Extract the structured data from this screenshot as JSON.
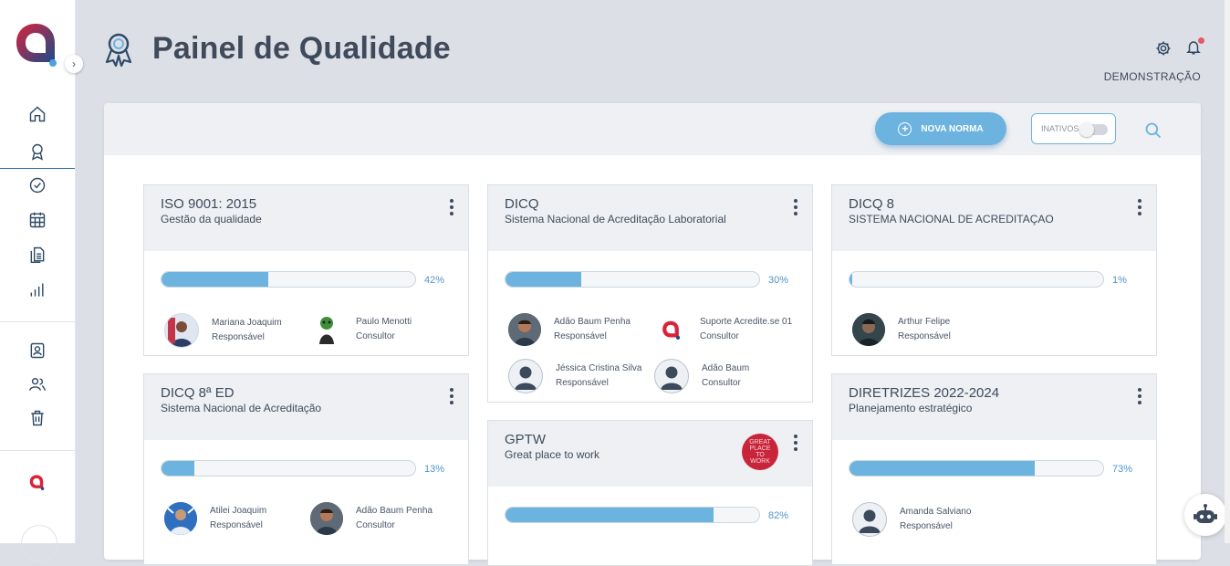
{
  "page": {
    "title": "Painel de Qualidade"
  },
  "header": {
    "company": "DEMONSTRAÇÃO"
  },
  "toolbar": {
    "new_norm_label": "NOVA NORMA",
    "inactive_label": "INATIVOS"
  },
  "sidebar": {
    "items": [
      {
        "icon": "home-icon"
      },
      {
        "icon": "award-icon",
        "active": true
      },
      {
        "icon": "check-circle-icon"
      },
      {
        "icon": "calendar-icon"
      },
      {
        "icon": "documents-icon"
      },
      {
        "icon": "bar-chart-icon"
      },
      {
        "icon": "user-card-icon"
      },
      {
        "icon": "users-icon"
      },
      {
        "icon": "trash-icon"
      }
    ]
  },
  "colors": {
    "accent": "#6cb3e0",
    "brand_red": "#d9233b",
    "brand_blue": "#1d4a8a"
  },
  "cards": {
    "iso": {
      "title": "ISO 9001: 2015",
      "subtitle": "Gestão da qualidade",
      "progress": 0.42,
      "progress_label": "42%",
      "members": [
        {
          "name": "Mariana Joaquim",
          "role": "Responsável"
        },
        {
          "name": "Paulo Menotti",
          "role": "Consultor"
        }
      ]
    },
    "dicq": {
      "title": "DICQ",
      "subtitle": "Sistema Nacional de Acreditação Laboratorial",
      "progress": 0.3,
      "progress_label": "30%",
      "members": [
        {
          "name": "Adão Baum Penha",
          "role": "Responsável"
        },
        {
          "name": "Suporte Acredite.se 01",
          "role": "Consultor"
        },
        {
          "name": "Jéssica Cristina Silva",
          "role": "Responsável"
        },
        {
          "name": "Adão Baum",
          "role": "Consultor"
        }
      ]
    },
    "dicq8": {
      "title": "DICQ 8",
      "subtitle": "SISTEMA NACIONAL DE ACREDITAÇAO",
      "progress": 0.01,
      "progress_label": "1%",
      "members": [
        {
          "name": "Arthur Felipe",
          "role": "Responsável"
        }
      ]
    },
    "dicq8ed": {
      "title": "DICQ 8ª ED",
      "subtitle": "Sistema Nacional de Acreditação",
      "progress": 0.13,
      "progress_label": "13%",
      "members": [
        {
          "name": "Atilei Joaquim",
          "role": "Responsável"
        },
        {
          "name": "Adão Baum Penha",
          "role": "Consultor"
        }
      ]
    },
    "gptw": {
      "title": "GPTW",
      "subtitle": "Great place to work",
      "progress": 0.82,
      "progress_label": "82%",
      "badge": [
        "GREAT",
        "PLACE",
        "TO",
        "WORK"
      ]
    },
    "diretrizes": {
      "title": "DIRETRIZES 2022-2024",
      "subtitle": "Planejamento estratégico",
      "progress": 0.73,
      "progress_label": "73%",
      "members": [
        {
          "name": "Amanda Salviano",
          "role": "Responsável"
        }
      ]
    }
  }
}
